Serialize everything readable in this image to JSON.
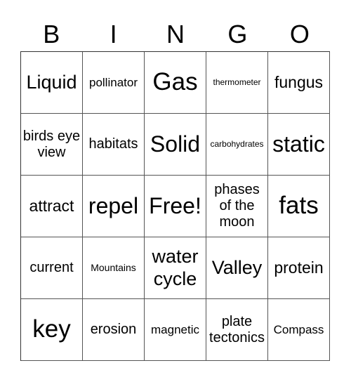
{
  "header": {
    "letters": [
      "B",
      "I",
      "N",
      "G",
      "O"
    ]
  },
  "card": {
    "rows": [
      [
        "Liquid",
        "pollinator",
        "Gas",
        "thermometer",
        "fungus"
      ],
      [
        "birds eye view",
        "habitats",
        "Solid",
        "carbohydrates",
        "static"
      ],
      [
        "attract",
        "repel",
        "Free!",
        "phases of the moon",
        "fats"
      ],
      [
        "current",
        "Mountains",
        "water cycle",
        "Valley",
        "protein"
      ],
      [
        "key",
        "erosion",
        "magnetic",
        "plate tectonics",
        "Compass"
      ]
    ]
  }
}
